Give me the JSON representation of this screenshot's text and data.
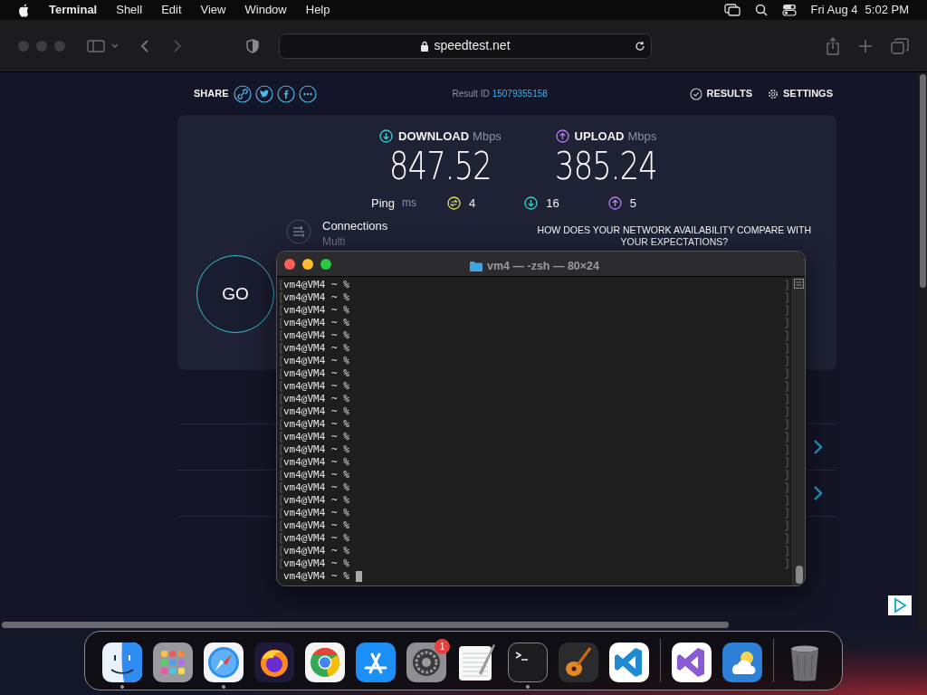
{
  "menu_bar": {
    "app": "Terminal",
    "menus": [
      "Shell",
      "Edit",
      "View",
      "Window",
      "Help"
    ],
    "date": "Fri Aug 4",
    "time": "5:02 PM"
  },
  "browser": {
    "url": "speedtest.net"
  },
  "speedtest": {
    "share_label": "SHARE",
    "share_links": [
      {
        "kind": "link"
      },
      {
        "kind": "twitter"
      },
      {
        "kind": "facebook"
      },
      {
        "kind": "more"
      }
    ],
    "result_id_label": "Result ID",
    "result_id": "15079355158",
    "results": "RESULTS",
    "settings": "SETTINGS",
    "download": {
      "label": "DOWNLOAD",
      "unit": "Mbps",
      "value": "847.52"
    },
    "upload": {
      "label": "UPLOAD",
      "unit": "Mbps",
      "value": "385.24"
    },
    "ping": {
      "label": "Ping",
      "unit": "ms",
      "values": [
        {
          "kind": "idle",
          "value": "4"
        },
        {
          "kind": "download",
          "value": "16"
        },
        {
          "kind": "upload",
          "value": "5"
        }
      ]
    },
    "connections": {
      "label": "Connections",
      "value": "Multi"
    },
    "go": "GO",
    "question": "HOW DOES YOUR NETWORK AVAILABILITY COMPARE WITH",
    "question_2": "YOUR EXPECTATIONS?"
  },
  "terminal": {
    "title": "vm4 — -zsh — 80×24",
    "lines": [
      {
        "prompt": "vm4@VM4 ~ %",
        "marked": true,
        "cursor": false
      },
      {
        "prompt": "vm4@VM4 ~ %",
        "marked": true,
        "cursor": false
      },
      {
        "prompt": "vm4@VM4 ~ %",
        "marked": true,
        "cursor": false
      },
      {
        "prompt": "vm4@VM4 ~ %",
        "marked": true,
        "cursor": false
      },
      {
        "prompt": "vm4@VM4 ~ %",
        "marked": true,
        "cursor": false
      },
      {
        "prompt": "vm4@VM4 ~ %",
        "marked": true,
        "cursor": false
      },
      {
        "prompt": "vm4@VM4 ~ %",
        "marked": true,
        "cursor": false
      },
      {
        "prompt": "vm4@VM4 ~ %",
        "marked": true,
        "cursor": false
      },
      {
        "prompt": "vm4@VM4 ~ %",
        "marked": true,
        "cursor": false
      },
      {
        "prompt": "vm4@VM4 ~ %",
        "marked": true,
        "cursor": false
      },
      {
        "prompt": "vm4@VM4 ~ %",
        "marked": true,
        "cursor": false
      },
      {
        "prompt": "vm4@VM4 ~ %",
        "marked": true,
        "cursor": false
      },
      {
        "prompt": "vm4@VM4 ~ %",
        "marked": true,
        "cursor": false
      },
      {
        "prompt": "vm4@VM4 ~ %",
        "marked": true,
        "cursor": false
      },
      {
        "prompt": "vm4@VM4 ~ %",
        "marked": true,
        "cursor": false
      },
      {
        "prompt": "vm4@VM4 ~ %",
        "marked": true,
        "cursor": false
      },
      {
        "prompt": "vm4@VM4 ~ %",
        "marked": true,
        "cursor": false
      },
      {
        "prompt": "vm4@VM4 ~ %",
        "marked": true,
        "cursor": false
      },
      {
        "prompt": "vm4@VM4 ~ %",
        "marked": true,
        "cursor": false
      },
      {
        "prompt": "vm4@VM4 ~ %",
        "marked": true,
        "cursor": false
      },
      {
        "prompt": "vm4@VM4 ~ %",
        "marked": true,
        "cursor": false
      },
      {
        "prompt": "vm4@VM4 ~ %",
        "marked": true,
        "cursor": false
      },
      {
        "prompt": "vm4@VM4 ~ %",
        "marked": true,
        "cursor": false
      },
      {
        "prompt": "vm4@VM4 ~ %",
        "marked": false,
        "cursor": true
      }
    ]
  },
  "dock": {
    "apps": [
      {
        "kind": "finder",
        "running": true
      },
      {
        "kind": "launchpad",
        "running": false
      },
      {
        "kind": "safari",
        "running": true
      },
      {
        "kind": "firefox",
        "running": false
      },
      {
        "kind": "chrome",
        "running": false
      },
      {
        "kind": "appstore",
        "running": false
      },
      {
        "kind": "settings",
        "running": false,
        "badge": "1"
      },
      {
        "kind": "textedit",
        "running": false
      },
      {
        "kind": "terminal",
        "running": true
      },
      {
        "kind": "garageband",
        "running": false
      },
      {
        "kind": "vscode",
        "running": false
      },
      {
        "kind": "separator"
      },
      {
        "kind": "visualstudio",
        "running": false
      },
      {
        "kind": "weather",
        "running": false
      },
      {
        "kind": "separator"
      },
      {
        "kind": "trash",
        "running": false
      }
    ]
  }
}
